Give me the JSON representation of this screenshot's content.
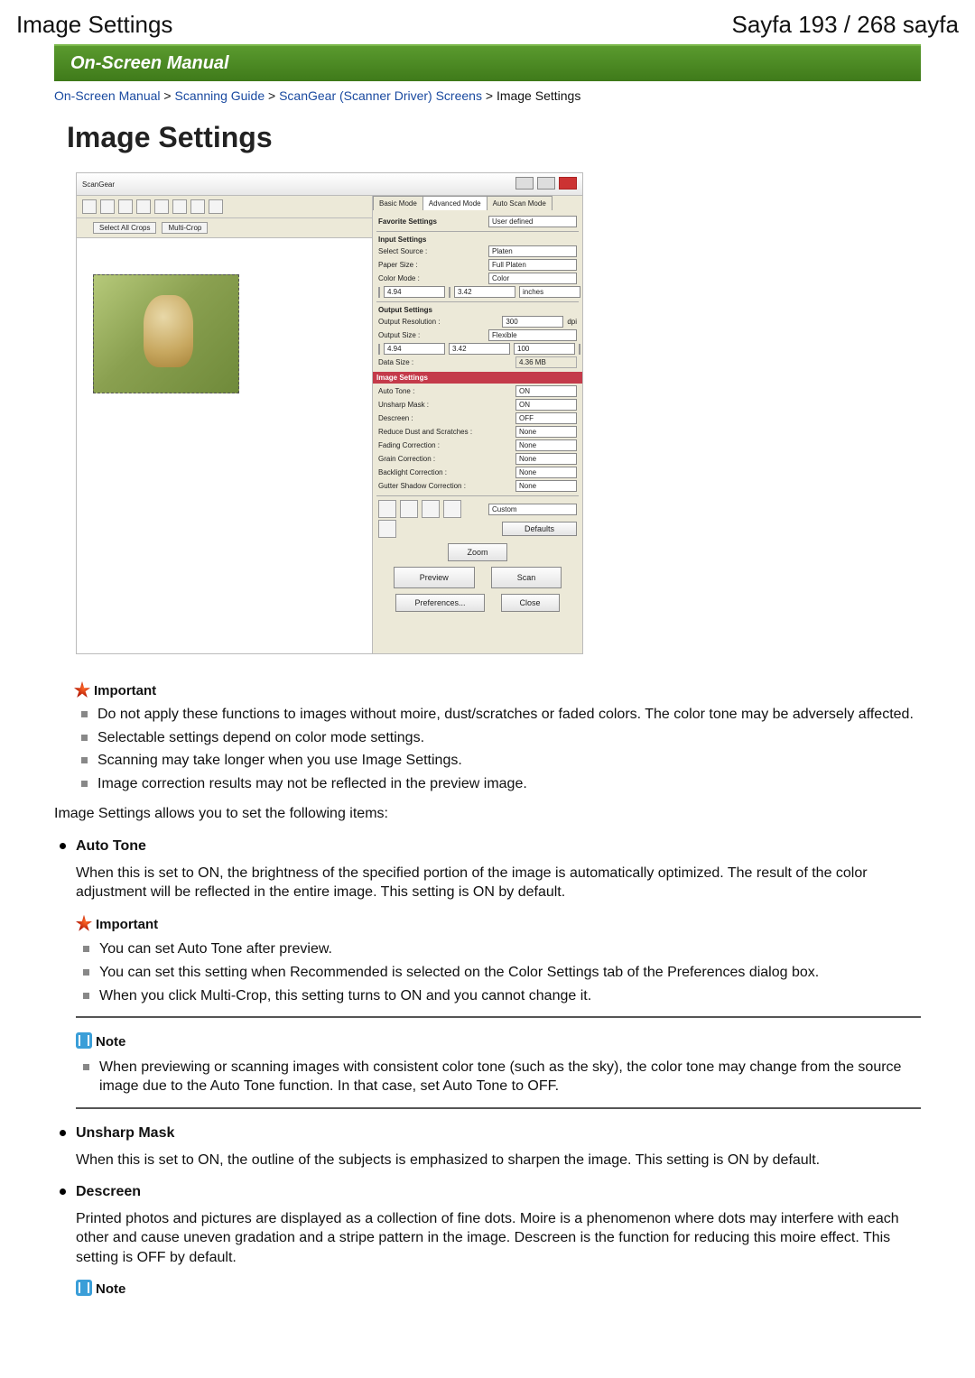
{
  "header": {
    "left": "Image Settings",
    "right": "Sayfa 193 / 268 sayfa"
  },
  "bar": {
    "title": "On-Screen Manual"
  },
  "crumbs": {
    "a1": "On-Screen Manual",
    "a2": "Scanning Guide",
    "a3": "ScanGear (Scanner Driver) Screens",
    "tail": "Image Settings",
    "sep": " > "
  },
  "title": "Image Settings",
  "scangear": {
    "winTitle": "ScanGear",
    "cropbar": {
      "selectAll": "Select All Crops",
      "multi": "Multi-Crop"
    },
    "tabs": {
      "basic": "Basic Mode",
      "advanced": "Advanced Mode",
      "auto": "Auto Scan Mode"
    },
    "favLabel": "Favorite Settings",
    "favValue": "User defined",
    "groups": {
      "input": "Input Settings",
      "output": "Output Settings",
      "image": "Image Settings"
    },
    "input": {
      "sourceL": "Select Source :",
      "sourceV": "Platen",
      "paperL": "Paper Size :",
      "paperV": "Full Platen",
      "colorL": "Color Mode :",
      "colorV": "Color",
      "dimW": "4.94",
      "dimH": "3.42",
      "unit": "inches"
    },
    "output": {
      "resL": "Output Resolution :",
      "resV": "300",
      "resU": "dpi",
      "sizeL": "Output Size :",
      "sizeV": "Flexible",
      "dimW": "4.94",
      "dimH": "3.42",
      "pct": "100",
      "dataL": "Data Size :",
      "dataV": "4.36 MB"
    },
    "image": {
      "autoToneL": "Auto Tone :",
      "autoToneV": "ON",
      "unsharpL": "Unsharp Mask :",
      "unsharpV": "ON",
      "descreenL": "Descreen :",
      "descreenV": "OFF",
      "dustL": "Reduce Dust and Scratches :",
      "dustV": "None",
      "fadeL": "Fading Correction :",
      "fadeV": "None",
      "grainL": "Grain Correction :",
      "grainV": "None",
      "backL": "Backlight Correction :",
      "backV": "None",
      "gutterL": "Gutter Shadow Correction :",
      "gutterV": "None"
    },
    "bottom": {
      "custom": "Custom",
      "defaults": "Defaults",
      "zoom": "Zoom",
      "preview": "Preview",
      "scan": "Scan",
      "prefs": "Preferences...",
      "close": "Close"
    }
  },
  "important1": {
    "title": "Important",
    "i1": "Do not apply these functions to images without moire, dust/scratches or faded colors. The color tone may be adversely affected.",
    "i2": "Selectable settings depend on color mode settings.",
    "i3": "Scanning may take longer when you use Image Settings.",
    "i4": "Image correction results may not be reflected in the preview image."
  },
  "intro": "Image Settings allows you to set the following items:",
  "autoTone": {
    "term": "Auto Tone",
    "desc": "When this is set to ON, the brightness of the specified portion of the image is automatically optimized. The result of the color adjustment will be reflected in the entire image. This setting is ON by default."
  },
  "important2": {
    "title": "Important",
    "i1": "You can set Auto Tone after preview.",
    "i2": "You can set this setting when Recommended is selected on the Color Settings tab of the Preferences dialog box.",
    "i3": "When you click Multi-Crop, this setting turns to ON and you cannot change it."
  },
  "note1": {
    "title": "Note",
    "i1": "When previewing or scanning images with consistent color tone (such as the sky), the color tone may change from the source image due to the Auto Tone function. In that case, set Auto Tone to OFF."
  },
  "unsharp": {
    "term": "Unsharp Mask",
    "desc": "When this is set to ON, the outline of the subjects is emphasized to sharpen the image. This setting is ON by default."
  },
  "descreen": {
    "term": "Descreen",
    "desc": "Printed photos and pictures are displayed as a collection of fine dots. Moire is a phenomenon where dots may interfere with each other and cause uneven gradation and a stripe pattern in the image. Descreen is the function for reducing this moire effect. This setting is OFF by default."
  },
  "note2": {
    "title": "Note"
  }
}
